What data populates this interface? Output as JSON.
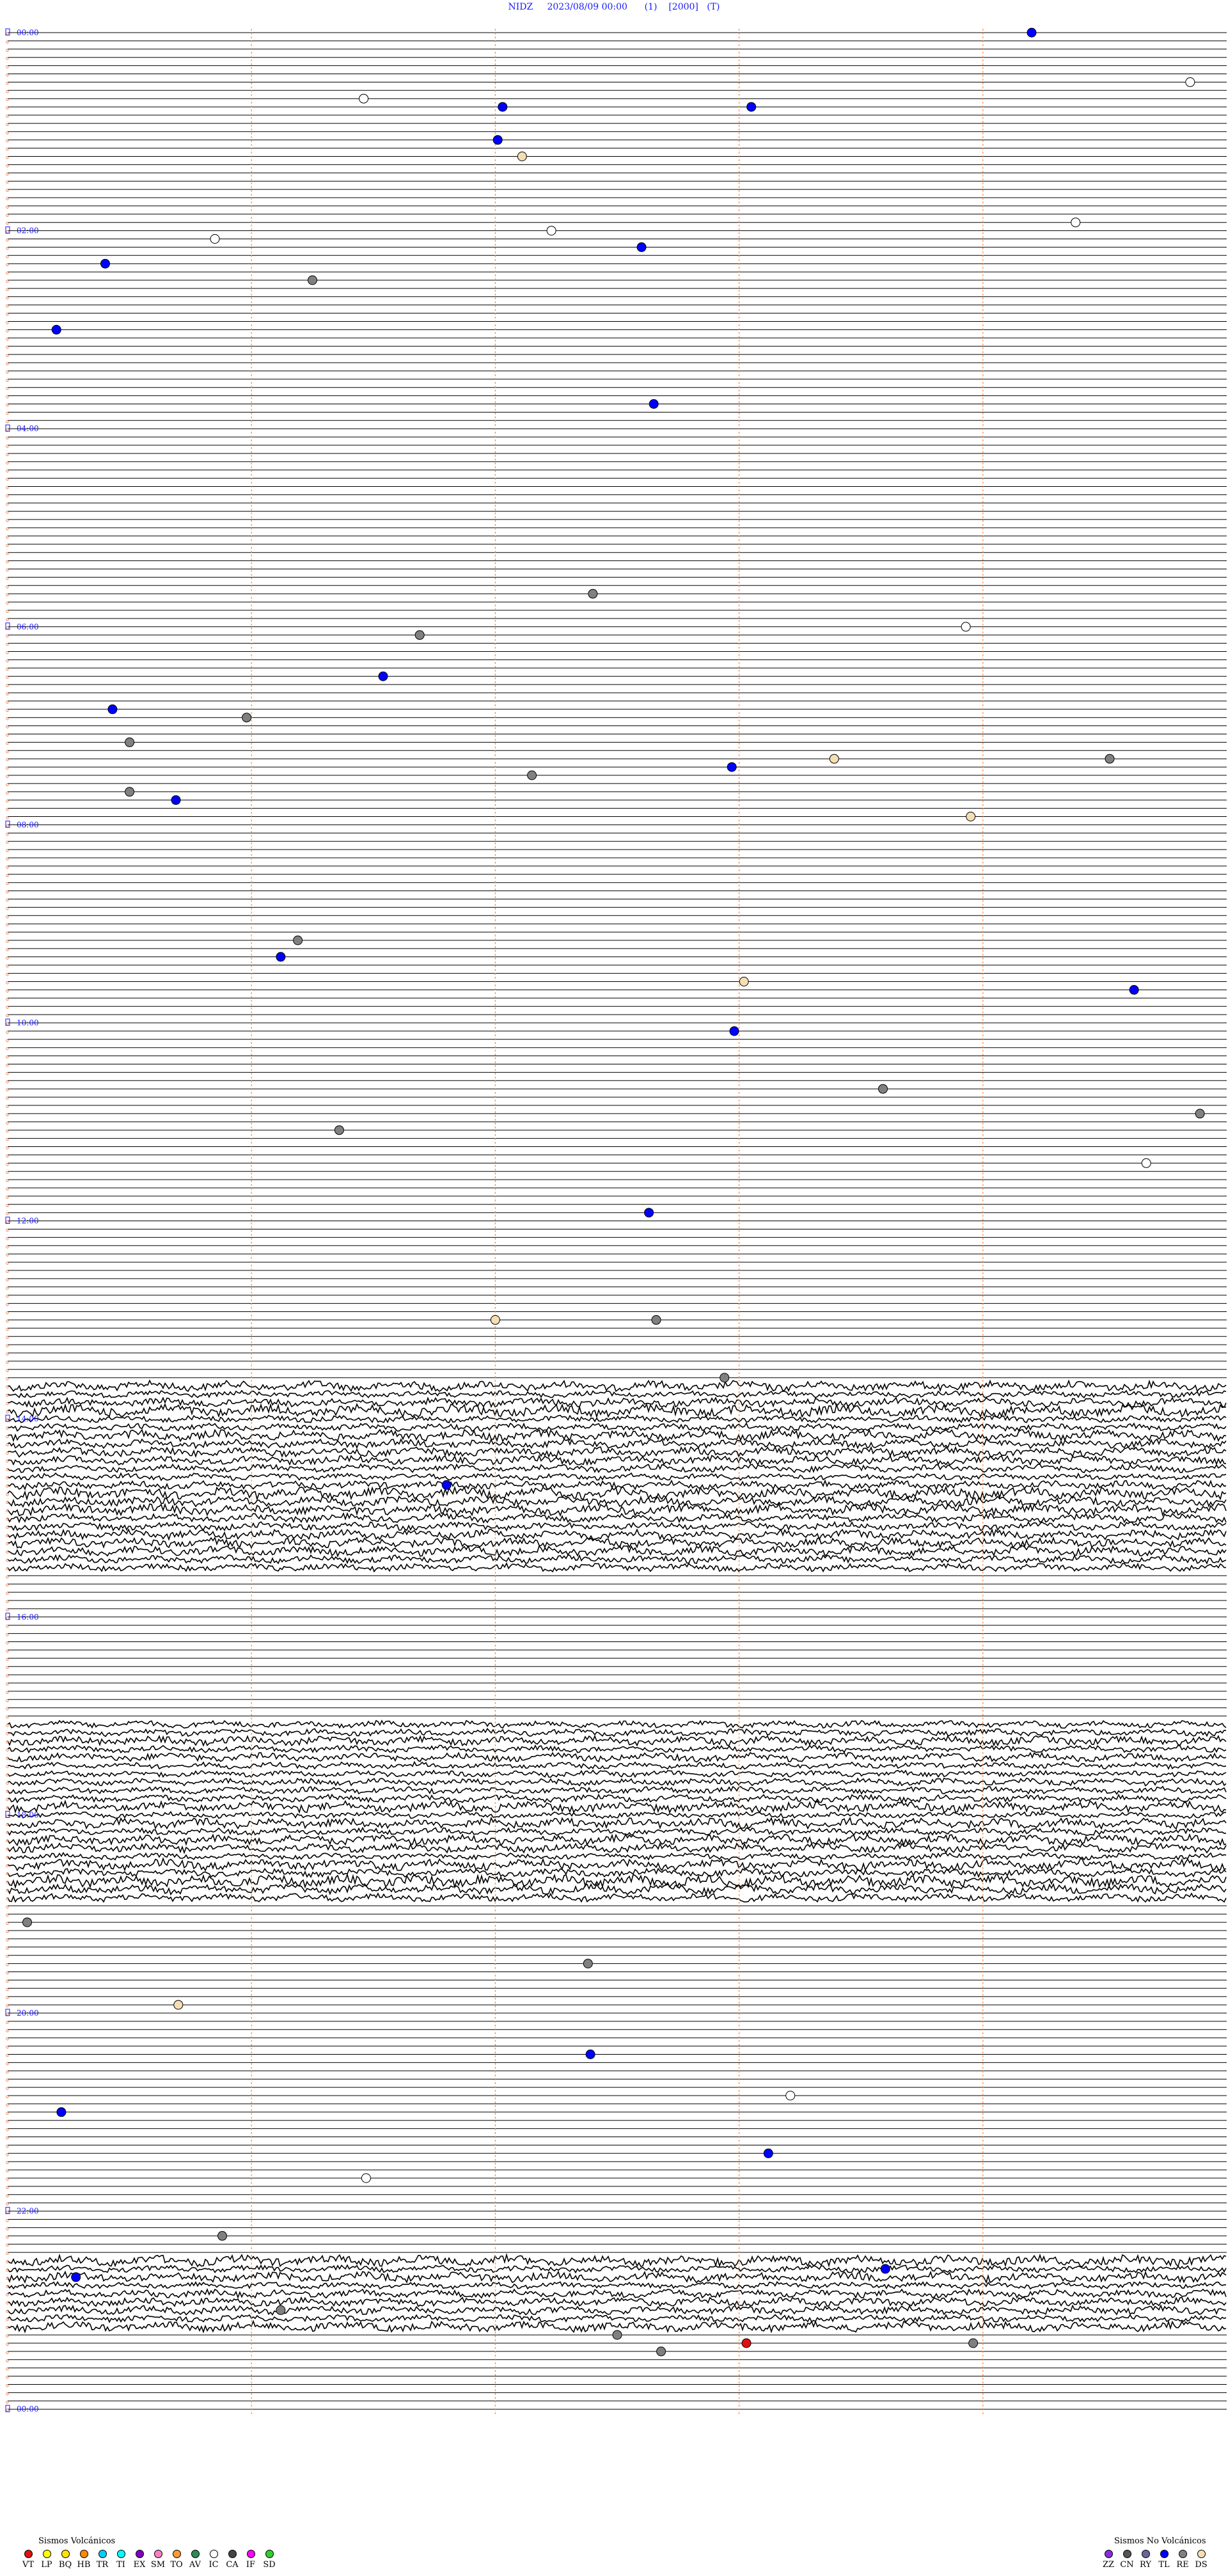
{
  "header": {
    "station": "NIDZ",
    "datetime": "2023/08/09 00:00",
    "tag1": "(1)",
    "tag2": "[2000]",
    "tag3": "(T)"
  },
  "chart_data": {
    "type": "scatter",
    "title": "NIDZ    2023/08/09 00:00      (1)    [2000]   (T)",
    "time_labels": [
      "00:00",
      "02:00",
      "04:00",
      "06:00",
      "08:00",
      "10:00",
      "12:00",
      "14:00",
      "16:00",
      "18:00",
      "20:00",
      "22:00",
      "00:00"
    ],
    "minutes_per_row": 5,
    "rows_total": 288,
    "x_range_minutes": [
      0,
      5
    ],
    "grid": true,
    "minute_gridlines": [
      1,
      2,
      3,
      4
    ],
    "noisy_row_ranges": [
      [
        164,
        186
      ],
      [
        205,
        226
      ],
      [
        270,
        278
      ]
    ],
    "events": [
      {
        "row": 0,
        "minute": 4.2,
        "type": "TL"
      },
      {
        "row": 6,
        "minute": 4.85,
        "type": "IC"
      },
      {
        "row": 8,
        "minute": 1.46,
        "type": "IC"
      },
      {
        "row": 9,
        "minute": 2.03,
        "type": "TL"
      },
      {
        "row": 9,
        "minute": 3.05,
        "type": "TL"
      },
      {
        "row": 13,
        "minute": 2.01,
        "type": "TL"
      },
      {
        "row": 15,
        "minute": 2.11,
        "type": "DS"
      },
      {
        "row": 23,
        "minute": 4.38,
        "type": "IC"
      },
      {
        "row": 24,
        "minute": 2.23,
        "type": "IC"
      },
      {
        "row": 25,
        "minute": 0.85,
        "type": "IC"
      },
      {
        "row": 26,
        "minute": 2.6,
        "type": "TL"
      },
      {
        "row": 28,
        "minute": 0.4,
        "type": "TL"
      },
      {
        "row": 30,
        "minute": 1.25,
        "type": "RE"
      },
      {
        "row": 36,
        "minute": 0.2,
        "type": "TL"
      },
      {
        "row": 45,
        "minute": 2.65,
        "type": "TL"
      },
      {
        "row": 68,
        "minute": 2.4,
        "type": "RE"
      },
      {
        "row": 72,
        "minute": 3.93,
        "type": "IC"
      },
      {
        "row": 73,
        "minute": 1.69,
        "type": "RE"
      },
      {
        "row": 78,
        "minute": 1.54,
        "type": "TL"
      },
      {
        "row": 82,
        "minute": 0.43,
        "type": "TL"
      },
      {
        "row": 83,
        "minute": 0.98,
        "type": "RE"
      },
      {
        "row": 86,
        "minute": 0.5,
        "type": "RE"
      },
      {
        "row": 88,
        "minute": 4.52,
        "type": "RE"
      },
      {
        "row": 88,
        "minute": 3.39,
        "type": "DS"
      },
      {
        "row": 89,
        "minute": 2.97,
        "type": "TL"
      },
      {
        "row": 90,
        "minute": 2.15,
        "type": "RE"
      },
      {
        "row": 92,
        "minute": 0.5,
        "type": "RE"
      },
      {
        "row": 93,
        "minute": 0.69,
        "type": "TL"
      },
      {
        "row": 95,
        "minute": 3.95,
        "type": "DS"
      },
      {
        "row": 110,
        "minute": 1.19,
        "type": "RE"
      },
      {
        "row": 112,
        "minute": 1.12,
        "type": "TL"
      },
      {
        "row": 115,
        "minute": 3.02,
        "type": "DS"
      },
      {
        "row": 116,
        "minute": 4.62,
        "type": "TL"
      },
      {
        "row": 121,
        "minute": 2.98,
        "type": "TL"
      },
      {
        "row": 128,
        "minute": 3.59,
        "type": "RE"
      },
      {
        "row": 131,
        "minute": 4.89,
        "type": "RE"
      },
      {
        "row": 133,
        "minute": 1.36,
        "type": "RE"
      },
      {
        "row": 137,
        "minute": 4.67,
        "type": "IC"
      },
      {
        "row": 143,
        "minute": 2.63,
        "type": "TL"
      },
      {
        "row": 156,
        "minute": 2.0,
        "type": "DS"
      },
      {
        "row": 156,
        "minute": 2.66,
        "type": "RE"
      },
      {
        "row": 163,
        "minute": 2.94,
        "type": "RE"
      },
      {
        "row": 176,
        "minute": 1.8,
        "type": "TL"
      },
      {
        "row": 229,
        "minute": 0.08,
        "type": "RE"
      },
      {
        "row": 234,
        "minute": 2.38,
        "type": "RE"
      },
      {
        "row": 239,
        "minute": 0.7,
        "type": "DS"
      },
      {
        "row": 245,
        "minute": 2.39,
        "type": "TL"
      },
      {
        "row": 250,
        "minute": 3.21,
        "type": "IC"
      },
      {
        "row": 252,
        "minute": 0.22,
        "type": "TL"
      },
      {
        "row": 257,
        "minute": 3.12,
        "type": "TL"
      },
      {
        "row": 260,
        "minute": 1.47,
        "type": "IC"
      },
      {
        "row": 267,
        "minute": 0.88,
        "type": "RE"
      },
      {
        "row": 271,
        "minute": 3.6,
        "type": "TL"
      },
      {
        "row": 272,
        "minute": 0.28,
        "type": "TL"
      },
      {
        "row": 276,
        "minute": 1.12,
        "type": "RE"
      },
      {
        "row": 279,
        "minute": 2.5,
        "type": "RE"
      },
      {
        "row": 280,
        "minute": 3.03,
        "type": "VT"
      },
      {
        "row": 280,
        "minute": 3.96,
        "type": "RE"
      },
      {
        "row": 281,
        "minute": 2.68,
        "type": "RE"
      }
    ]
  },
  "legend_volcanic": {
    "title": "Sismos Volcánicos",
    "items": [
      {
        "code": "VT",
        "color": "#e01010"
      },
      {
        "code": "LP",
        "color": "#ffff00"
      },
      {
        "code": "BQ",
        "color": "#ffe300"
      },
      {
        "code": "HB",
        "color": "#ff8800"
      },
      {
        "code": "TR",
        "color": "#00ccff"
      },
      {
        "code": "TI",
        "color": "#00ffff"
      },
      {
        "code": "EX",
        "color": "#8000c0"
      },
      {
        "code": "SM",
        "color": "#ff80c0"
      },
      {
        "code": "TO",
        "color": "#ff9933"
      },
      {
        "code": "AV",
        "color": "#2e8b57"
      },
      {
        "code": "IC",
        "color": "#ffffff"
      },
      {
        "code": "CA",
        "color": "#444444"
      },
      {
        "code": "IF",
        "color": "#ff00ff"
      },
      {
        "code": "SD",
        "color": "#33cc33"
      }
    ]
  },
  "legend_nonvolcanic": {
    "title": "Sismos No Volcánicos",
    "items": [
      {
        "code": "ZZ",
        "color": "#8a2be2"
      },
      {
        "code": "CN",
        "color": "#555555"
      },
      {
        "code": "RY",
        "color": "#666699"
      },
      {
        "code": "TL",
        "color": "#0000ff"
      },
      {
        "code": "RE",
        "color": "#808080"
      },
      {
        "code": "DS",
        "color": "#f5deb3"
      }
    ]
  },
  "colors": {
    "trace": "#000000",
    "time_label": "#1a1aff",
    "minute_grid": "#ff8c42",
    "row_marker": "#e06a3a"
  }
}
